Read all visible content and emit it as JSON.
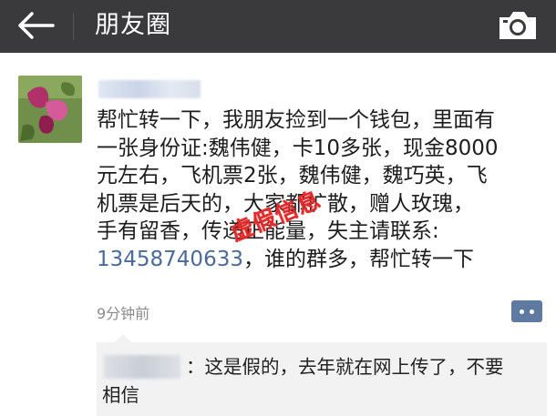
{
  "header": {
    "title": "朋友圈",
    "back_icon": "back-arrow-icon",
    "camera_icon": "camera-icon",
    "background": "#3a3a3d"
  },
  "post": {
    "lines": [
      "帮忙转一下，我朋友捡到一个钱包，里面有",
      "一张身份证:魏伟健，卡10多张，现金8000",
      "元左右，飞机票2张，魏伟健，魏巧英，飞",
      "机票是后天的，大家都扩散，赠人玫瑰，",
      "手有留香，传递正能量，失主请联系:"
    ],
    "phone": "13458740633",
    "last_line_rest": "，谁的群多，帮忙转一下",
    "stamp": "虚假信息",
    "time": "9分钟前"
  },
  "comment": {
    "text": "：这是假的，去年就在网上传了，不要",
    "text_line2": "相信"
  },
  "colors": {
    "link": "#4a6a9a",
    "stamp": "#e22b2b",
    "more_button": "#5f7aa0"
  }
}
